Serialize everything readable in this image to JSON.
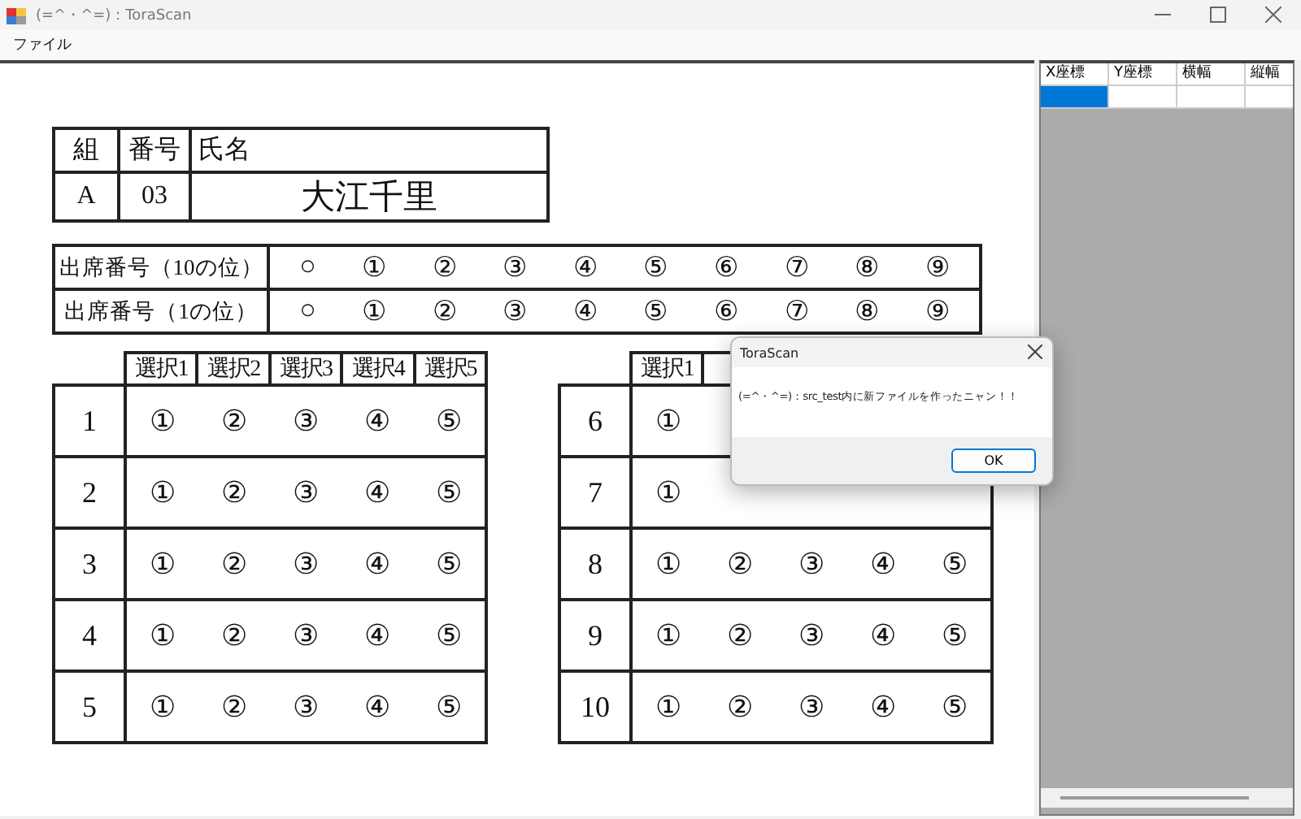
{
  "window": {
    "title": "(=^・^=)：ToraScan"
  },
  "menu": [
    "ファイル"
  ],
  "sheet": {
    "header_table": {
      "columns": [
        "組",
        "番号",
        "氏名"
      ],
      "values": [
        "A",
        "03",
        "大江千里"
      ]
    },
    "attendance": [
      {
        "label": "出席番号（10の位）",
        "marks": [
          "○",
          "①",
          "②",
          "③",
          "④",
          "⑤",
          "⑥",
          "⑦",
          "⑧",
          "⑨"
        ]
      },
      {
        "label": "出席番号（1の位）",
        "marks": [
          "○",
          "①",
          "②",
          "③",
          "④",
          "⑤",
          "⑥",
          "⑦",
          "⑧",
          "⑨"
        ]
      }
    ],
    "answer_tables": [
      {
        "columns": [
          "選択1",
          "選択2",
          "選択3",
          "選択4",
          "選択5"
        ],
        "rows": [
          {
            "number": "1",
            "marks": [
              "①",
              "②",
              "③",
              "④",
              "⑤"
            ]
          },
          {
            "number": "2",
            "marks": [
              "①",
              "②",
              "③",
              "④",
              "⑤"
            ]
          },
          {
            "number": "3",
            "marks": [
              "①",
              "②",
              "③",
              "④",
              "⑤"
            ]
          },
          {
            "number": "4",
            "marks": [
              "①",
              "②",
              "③",
              "④",
              "⑤"
            ]
          },
          {
            "number": "5",
            "marks": [
              "①",
              "②",
              "③",
              "④",
              "⑤"
            ]
          }
        ]
      },
      {
        "columns": [
          "選択1"
        ],
        "rows": [
          {
            "number": "6",
            "marks": [
              "①"
            ]
          },
          {
            "number": "7",
            "marks": [
              "①"
            ]
          },
          {
            "number": "8",
            "marks": [
              "①",
              "②",
              "③",
              "④",
              "⑤"
            ]
          },
          {
            "number": "9",
            "marks": [
              "①",
              "②",
              "③",
              "④",
              "⑤"
            ]
          },
          {
            "number": "10",
            "marks": [
              "①",
              "②",
              "③",
              "④",
              "⑤"
            ]
          }
        ]
      }
    ]
  },
  "grid": {
    "columns": [
      "X座標",
      "Y座標",
      "横幅",
      "縦幅"
    ],
    "rows": [
      {
        "cells": [
          {
            "selected": true
          },
          {
            "selected": false
          },
          {
            "selected": false
          },
          {
            "selected": false
          }
        ]
      }
    ]
  },
  "dialog": {
    "title": "ToraScan",
    "message": "(=^・^=)：src_test内に新ファイルを作ったニャン！！",
    "buttons": [
      "OK"
    ]
  }
}
